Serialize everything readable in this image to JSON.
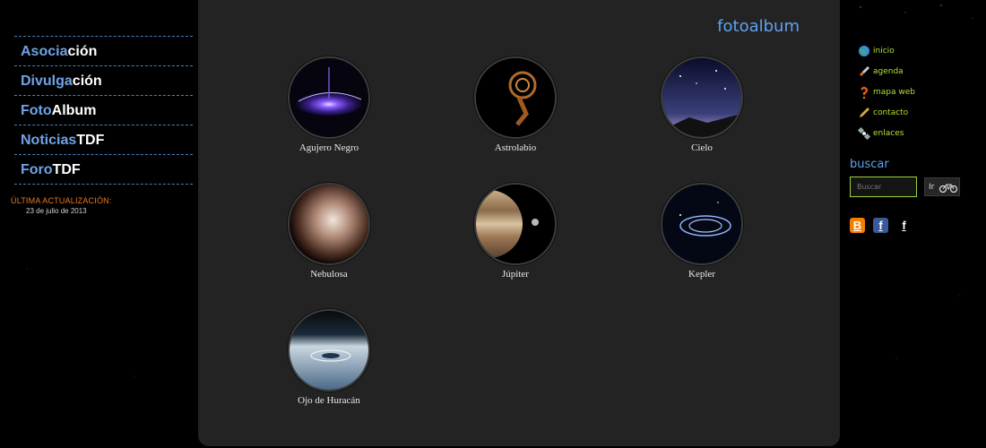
{
  "left_nav": {
    "items": [
      {
        "a": "Asocia",
        "b": "ción"
      },
      {
        "a": "Divulga",
        "b": "ción"
      },
      {
        "a": "Foto",
        "b": "Album"
      },
      {
        "a": "Noticias",
        "b": "TDF"
      },
      {
        "a": "Foro",
        "b": "TDF"
      }
    ],
    "update_label": "ÚLTIMA ACTUALIZACIÓN:",
    "update_date": "23 de julio de 2013"
  },
  "main": {
    "title": "fotoalbum",
    "tiles": [
      {
        "label": "Agujero Negro",
        "image": "black-hole"
      },
      {
        "label": "Astrolabio",
        "image": "astrolabe"
      },
      {
        "label": "Cielo",
        "image": "sky"
      },
      {
        "label": "Nebulosa",
        "image": "nebula"
      },
      {
        "label": "Júpiter",
        "image": "jupiter"
      },
      {
        "label": "Kepler",
        "image": "kepler"
      },
      {
        "label": "Ojo de Huracán",
        "image": "hurricane-eye"
      }
    ]
  },
  "right": {
    "links": [
      {
        "label": "inicio",
        "icon": "globe-icon"
      },
      {
        "label": "agenda",
        "icon": "rocket-icon"
      },
      {
        "label": "mapa web",
        "icon": "question-icon"
      },
      {
        "label": "contacto",
        "icon": "pencil-icon"
      },
      {
        "label": "enlaces",
        "icon": "satellite-icon"
      }
    ],
    "search_heading": "buscar",
    "search_placeholder": "Buscar",
    "search_button": "Ir",
    "social": [
      {
        "name": "blogger-icon",
        "glyph": "B",
        "color": "#f57d00"
      },
      {
        "name": "facebook-icon",
        "glyph": "f",
        "color": "#3b5998"
      },
      {
        "name": "facebook-plain-icon",
        "glyph": "f",
        "color": "#000000"
      }
    ]
  },
  "colors": {
    "accent_blue": "#6fa3e6",
    "link_green": "#b3e033",
    "update_orange": "#e87a22",
    "panel": "#232323"
  }
}
